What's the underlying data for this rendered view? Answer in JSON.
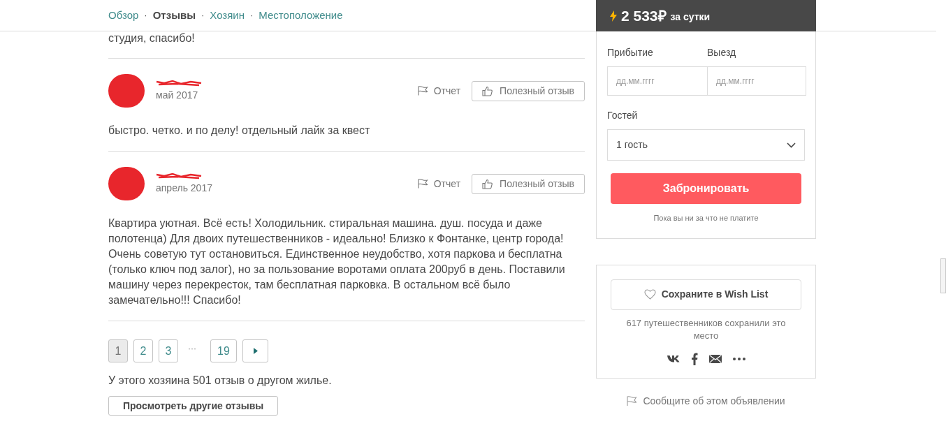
{
  "nav": [
    {
      "label": "Обзор",
      "selected": false
    },
    {
      "label": "Отзывы",
      "selected": true
    },
    {
      "label": "Хозяин",
      "selected": false
    },
    {
      "label": "Местоположение",
      "selected": false
    }
  ],
  "nav_separator": "·",
  "previous_review_tail": "студия, спасибо!",
  "reviews": [
    {
      "date": "май 2017",
      "report": "Отчет",
      "helpful": "Полезный отзыв",
      "text": "быстро. четко. и по делу! отдельный лайк за квест"
    },
    {
      "date": "апрель 2017",
      "report": "Отчет",
      "helpful": "Полезный отзыв",
      "text": "Квартира уютная. Всё есть! Холодильник. стиральная машина. душ. посуда и даже полотенца) Для двоих путешественников - идеально! Близко к Фонтанке, центр города! Очень советую тут остановиться. Единственное неудобство, хотя паркова и бесплатна (только ключ под залог), но за пользование воротами оплата 200руб в день. Поставили машину через перекресток, там бесплатная парковка. В остальном всё было замечательно!!! Спасибо!"
    }
  ],
  "pagination": [
    {
      "kind": "page",
      "label": "1",
      "selected": true
    },
    {
      "kind": "page",
      "label": "2",
      "selected": false
    },
    {
      "kind": "page",
      "label": "3",
      "selected": false
    },
    {
      "kind": "gap",
      "label": "···"
    },
    {
      "kind": "page",
      "label": "19",
      "selected": false
    },
    {
      "kind": "next"
    }
  ],
  "host_note": "У этого хозяина 501 отзыв о другом жилье.",
  "other_reviews_button": "Просмотреть другие отзывы",
  "booking": {
    "price": "2 533₽",
    "per": "за сутки",
    "checkin_label": "Прибытие",
    "checkin_placeholder": "дд.мм.гггг",
    "checkout_label": "Выезд",
    "checkout_placeholder": "дд.мм.гггг",
    "guests_label": "Гостей",
    "guests_value": "1 гость",
    "book_button": "Забронировать",
    "note": "Пока вы ни за что не платите"
  },
  "wishlist": {
    "button": "Сохраните в Wish List",
    "count_text": "617 путешественников сохранили это место"
  },
  "report_listing": "Сообщите об этом объявлении"
}
